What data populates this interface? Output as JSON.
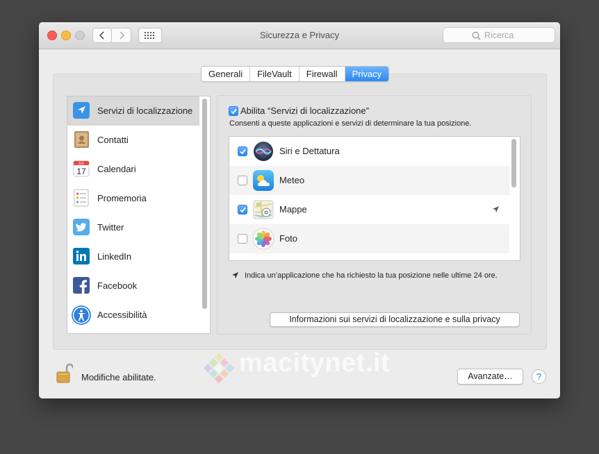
{
  "window": {
    "title": "Sicurezza e Privacy",
    "search_placeholder": "Ricerca"
  },
  "tabs": [
    {
      "label": "Generali",
      "active": false
    },
    {
      "label": "FileVault",
      "active": false
    },
    {
      "label": "Firewall",
      "active": false
    },
    {
      "label": "Privacy",
      "active": true
    }
  ],
  "sidebar": {
    "items": [
      {
        "label": "Servizi di localizzazione",
        "icon": "location-icon",
        "selected": true
      },
      {
        "label": "Contatti",
        "icon": "contacts-icon"
      },
      {
        "label": "Calendari",
        "icon": "calendar-icon",
        "icon_text": "17",
        "icon_month": "JUL"
      },
      {
        "label": "Promemoria",
        "icon": "reminders-icon"
      },
      {
        "label": "Twitter",
        "icon": "twitter-icon"
      },
      {
        "label": "LinkedIn",
        "icon": "linkedin-icon"
      },
      {
        "label": "Facebook",
        "icon": "facebook-icon"
      },
      {
        "label": "Accessibilità",
        "icon": "accessibility-icon"
      }
    ]
  },
  "location": {
    "enable_checked": true,
    "enable_label": "Abilita “Servizi di localizzazione”",
    "description": "Consenti a queste applicazioni e servizi di determinare la tua posizione.",
    "apps": [
      {
        "name": "Siri e Dettatura",
        "checked": true,
        "icon": "siri-icon",
        "recent": false
      },
      {
        "name": "Meteo",
        "checked": false,
        "icon": "weather-icon",
        "recent": false
      },
      {
        "name": "Mappe",
        "checked": true,
        "icon": "maps-icon",
        "recent": true
      },
      {
        "name": "Foto",
        "checked": false,
        "icon": "photos-icon",
        "recent": false
      }
    ],
    "note": "Indica un’applicazione che ha richiesto la tua posizione nelle ultime 24 ore.",
    "info_button": "Informazioni sui servizi di localizzazione e sulla privacy"
  },
  "footer": {
    "lock_label": "Modifiche abilitate.",
    "advanced_button": "Avanzate…",
    "help_label": "?"
  },
  "watermark": {
    "text": "macitynet.it"
  },
  "colors": {
    "accent": "#2b88f0",
    "window_bg": "#ececec",
    "desktop": "#464646"
  }
}
